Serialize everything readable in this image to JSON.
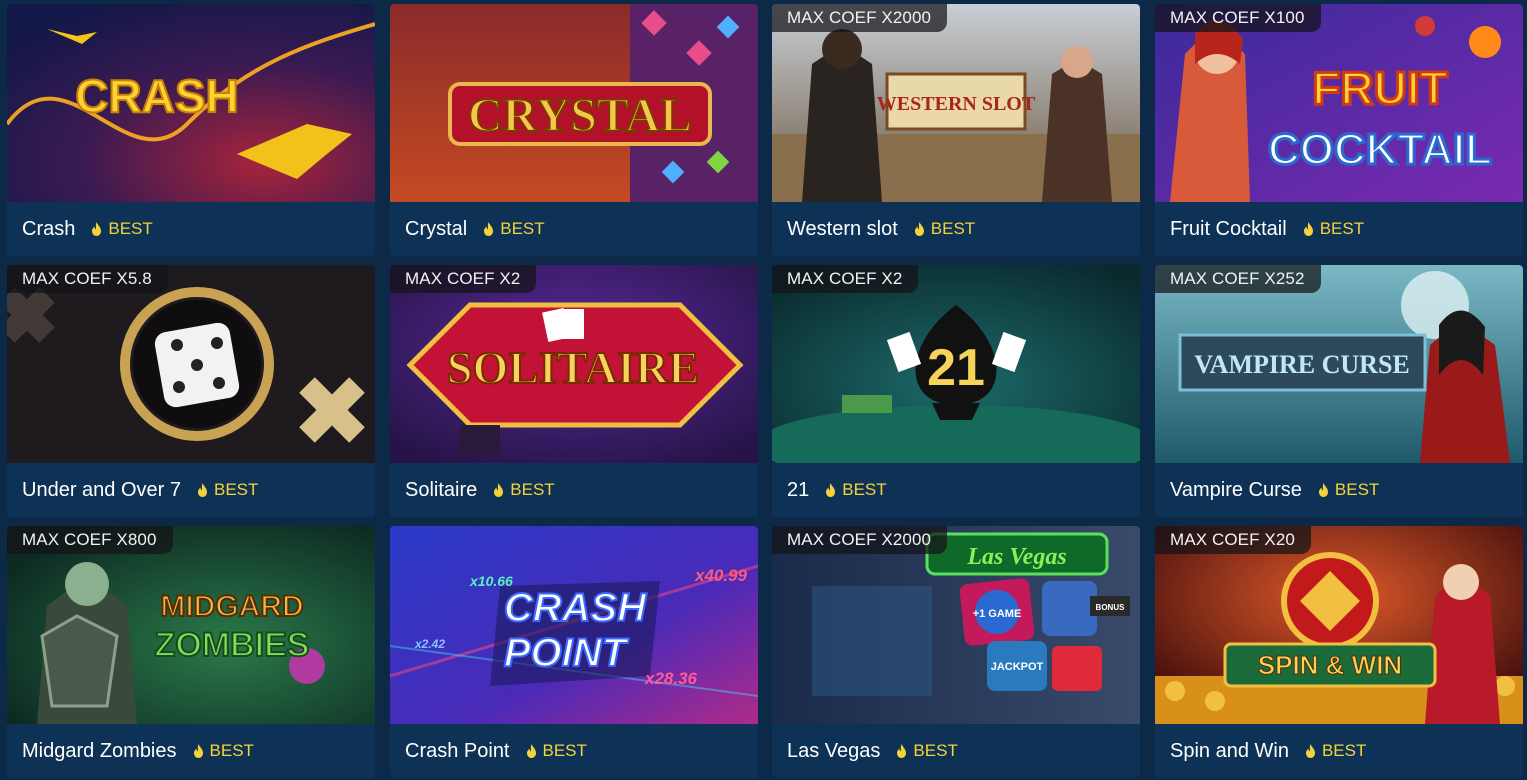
{
  "cards": [
    {
      "title": "Crash",
      "coef": "",
      "badge": "BEST",
      "art": "crash",
      "art_text": "CRASH"
    },
    {
      "title": "Crystal",
      "coef": "",
      "badge": "BEST",
      "art": "crystal",
      "art_text": "CRYSTAL"
    },
    {
      "title": "Western slot",
      "coef": "MAX COEF X2000",
      "badge": "BEST",
      "art": "western",
      "art_text": "WESTERN SLOT"
    },
    {
      "title": "Fruit Cocktail",
      "coef": "MAX COEF X100",
      "badge": "BEST",
      "art": "fruit",
      "art_text": "FRUIT",
      "art_text2": "COCKTAIL"
    },
    {
      "title": "Under and Over 7",
      "coef": "MAX COEF X5.8",
      "badge": "BEST",
      "art": "dice",
      "art_text": ""
    },
    {
      "title": "Solitaire",
      "coef": "MAX COEF X2",
      "badge": "BEST",
      "art": "solitaire",
      "art_text": "SOLITAIRE"
    },
    {
      "title": "21",
      "coef": "MAX COEF X2",
      "badge": "BEST",
      "art": "blackjack",
      "art_text": "21"
    },
    {
      "title": "Vampire Curse",
      "coef": "MAX COEF X252",
      "badge": "BEST",
      "art": "vampire",
      "art_text": "VAMPIRE CURSE"
    },
    {
      "title": "Midgard Zombies",
      "coef": "MAX COEF X800",
      "badge": "BEST",
      "art": "zombies",
      "art_text": "MIDGARD",
      "art_text2": "ZOMBIES"
    },
    {
      "title": "Crash Point",
      "coef": "",
      "badge": "BEST",
      "art": "crashpoint",
      "art_text": "CRASH",
      "art_text2": "POINT",
      "multipliers": [
        "x10.66",
        "x40.99",
        "x2.42",
        "x28.36"
      ]
    },
    {
      "title": "Las Vegas",
      "coef": "MAX COEF X2000",
      "badge": "BEST",
      "art": "vegas",
      "art_text": "Las Vegas",
      "chips": [
        "+1 GAME",
        "JACKPOT",
        "BONUS"
      ]
    },
    {
      "title": "Spin and Win",
      "coef": "MAX COEF X20",
      "badge": "BEST",
      "art": "spin",
      "art_text": "SPIN & WIN"
    }
  ],
  "badge_color": "#f4d33a",
  "card_color": "#0e3256",
  "page_color": "#0c2a47",
  "badge_icon": "flame-icon"
}
